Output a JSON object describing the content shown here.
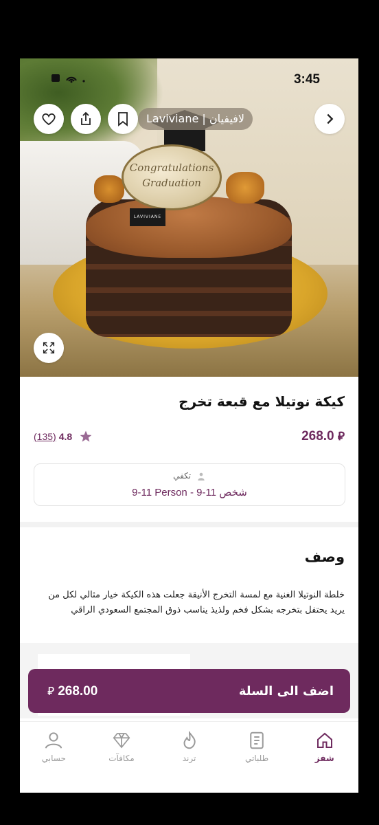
{
  "status_bar": {
    "time": "3:45",
    "icons": "signal wifi"
  },
  "header": {
    "store_name": "Laviviane | لافيفيان",
    "back_icon": "chevron-right-icon",
    "favorite_icon": "heart-icon",
    "share_icon": "share-icon",
    "bookmark_icon": "bookmark-icon",
    "expand_icon": "expand-icon"
  },
  "hero": {
    "topper_text_line1": "Congratulations",
    "topper_text_line2": "Graduation",
    "cake_label": "LAVIVIANE"
  },
  "product": {
    "title": "كيكة نوتيلا مع قبعة تخرج",
    "price": "268.0",
    "rating_value": "4.8",
    "rating_count": "(135)",
    "serves_label": "تكفي",
    "serves_value": "9-11 Person - 9-11 شخص"
  },
  "description": {
    "heading": "وصف",
    "body": "خلطة النوتيلا الغنية مع لمسة التخرج الأنيقة جعلت هذه الكيكة خيار مثالي لكل من يريد يحتفل بتخرجه بشكل فخم ولذيذ يناسب ذوق المجتمع السعودي الراقي"
  },
  "cart_button": {
    "label": "اضف الى السلة",
    "price": "268.00"
  },
  "bottom_nav": [
    {
      "label": "شفز",
      "icon": "home-icon",
      "active": true
    },
    {
      "label": "طلباتي",
      "icon": "orders-icon",
      "active": false
    },
    {
      "label": "ترند",
      "icon": "flame-icon",
      "active": false
    },
    {
      "label": "مكافآت",
      "icon": "diamond-icon",
      "active": false
    },
    {
      "label": "حسابي",
      "icon": "user-icon",
      "active": false
    }
  ],
  "colors": {
    "brand": "#6e2a5e",
    "inactive": "#9a9a9a"
  }
}
